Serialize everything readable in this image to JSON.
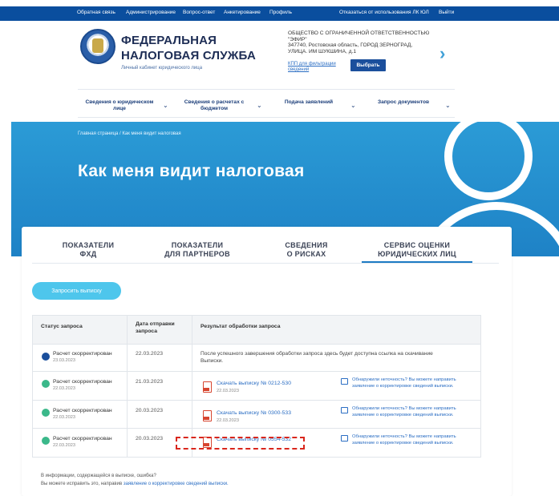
{
  "topbar": {
    "links": [
      "Обратная связь",
      "Администрирование",
      "Вопрос-ответ",
      "Анкетирование",
      "Профиль"
    ],
    "right_links": [
      "Отказаться от использования ЛК ЮЛ",
      "Выйти"
    ]
  },
  "header": {
    "brand_line1": "ФЕДЕРАЛЬНАЯ",
    "brand_line2": "НАЛОГОВАЯ СЛУЖБА",
    "brand_sub": "Личный кабинет юридического лица",
    "org_name_line1": "ОБЩЕСТВО С ОГРАНИЧЕННОЙ ОТВЕТСТВЕННОСТЬЮ",
    "org_name_line2": "\"ЭФИР\"",
    "org_address_line1": "347740, Ростовская область, ГОРОД ЗЕРНОГРАД,",
    "org_address_line2": "УЛИЦА. ИМ ШУКШИНА, д.1",
    "kpp_link": "КПП для фильтрации сведений",
    "select_button": "Выбрать"
  },
  "menu": [
    "Сведения о юридическом лице",
    "Сведения о расчетах с бюджетом",
    "Подача заявлений",
    "Запрос документов"
  ],
  "banner": {
    "breadcrumb": "Главная страница / Как меня видит налоговая",
    "title": "Как меня видит налоговая"
  },
  "tabs": [
    {
      "line1": "ПОКАЗАТЕЛИ",
      "line2": "ФХД"
    },
    {
      "line1": "ПОКАЗАТЕЛИ",
      "line2": "ДЛЯ ПАРТНЕРОВ"
    },
    {
      "line1": "СВЕДЕНИЯ",
      "line2": "О РИСКАХ"
    },
    {
      "line1": "СЕРВИС ОЦЕНКИ",
      "line2": "ЮРИДИЧЕСКИХ ЛИЦ"
    }
  ],
  "request_button": "Запросить выписку",
  "table": {
    "headers": {
      "status": "Статус запроса",
      "date_line1": "Дата отправки",
      "date_line2": "запроса",
      "result": "Результат обработки запроса"
    },
    "rows": [
      {
        "status": "Расчет скорректирован",
        "status_date": "23.03.2023",
        "sent": "22.03.2023",
        "result_line1": "После успешного завершения обработки запроса здесь будет доступна ссылка на скачивание",
        "result_line2": "Выписки.",
        "dot_color": "#1b4f9c"
      },
      {
        "status": "Расчет скорректирован",
        "status_date": "22.03.2023",
        "sent": "21.03.2023",
        "link": "Скачать выписку № 0212-530",
        "link_date": "22.03.2023",
        "error_line1": "Обнаружили неточность? Вы можете направить",
        "error_line2": "заявление о корректировке сведений выписки.",
        "dot_color": "#3bb88a"
      },
      {
        "status": "Расчет скорректирован",
        "status_date": "22.03.2023",
        "sent": "20.03.2023",
        "link": "Скачать выписку № 0300-533",
        "link_date": "22.03.2023",
        "error_line1": "Обнаружили неточность? Вы можете направить",
        "error_line2": "заявление о корректировке сведений выписки.",
        "dot_color": "#3bb88a"
      },
      {
        "status": "Расчет скорректирован",
        "status_date": "22.03.2023",
        "sent": "20.03.2023",
        "link": "Скачать выписку № 0554-532",
        "error_line1": "Обнаружили неточность? Вы можете направить",
        "error_line2": "заявление о корректировке сведений выписки.",
        "dot_color": "#3bb88a"
      }
    ]
  },
  "footer": {
    "line1": "В информации, содержащейся в выписке, ошибка?",
    "line2_prefix": "Вы можете исправить это, направив ",
    "line2_link": "заявление о корректировке сведений выписки."
  }
}
